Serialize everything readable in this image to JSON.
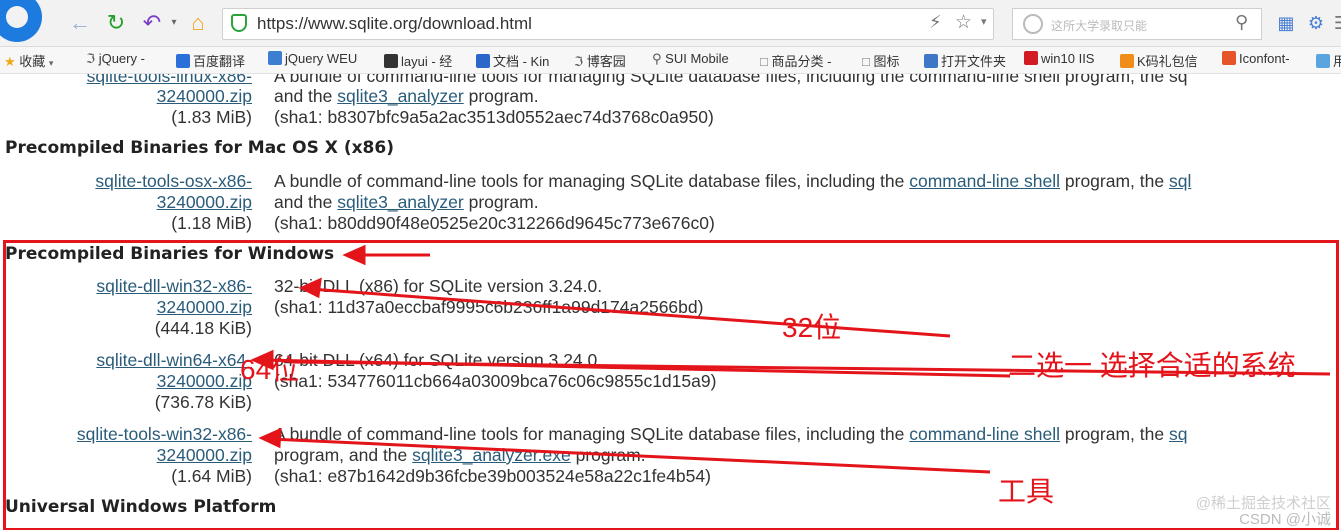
{
  "browser": {
    "url": "https://www.sqlite.org/download.html",
    "search_placeholder": "这所大学录取只能",
    "bookmarks": [
      "收藏",
      "jQuery -",
      "百度翻译",
      "jQuery WEU",
      "layui - 经",
      "文档 - Kin",
      "博客园",
      "SUI Mobile",
      "商品分类 -",
      "图标",
      "打开文件夹",
      "win10 IIS",
      "K码礼包信",
      "Iconfont-",
      "用"
    ]
  },
  "page": {
    "top_partial": {
      "file_top": "sqlite-tools-linux-x86-",
      "desc_top": "A bundle of command-line tools for managing SQLite database files, including the command-line shell program, the sq",
      "file_bottom": "3240000.zip",
      "size": "(1.83 MiB)",
      "desc_line2_prefix": "and the ",
      "desc_line2_link": "sqlite3_analyzer",
      "desc_line2_suffix": " program.",
      "sha1": "(sha1: b8307bfc9a5a2ac3513d0552aec74d3768c0a950)"
    },
    "mac_heading": "Precompiled Binaries for Mac OS X (x86)",
    "mac_entry": {
      "file_top": "sqlite-tools-osx-x86-",
      "file_bottom": "3240000.zip",
      "size": "(1.18 MiB)",
      "desc_prefix": "A bundle of command-line tools for managing SQLite database files, including the ",
      "desc_link": "command-line shell",
      "desc_suffix": " program, the ",
      "desc_tail_link": "sql",
      "desc_line2_prefix": "and the ",
      "desc_line2_link": "sqlite3_analyzer",
      "desc_line2_suffix": " program.",
      "sha1": "(sha1: b80dd90f48e0525e20c312266d9645c773e676c0)"
    },
    "win_heading": "Precompiled Binaries for Windows",
    "win_entries": [
      {
        "file_top": "sqlite-dll-win32-x86-",
        "file_bottom": "3240000.zip",
        "size": "(444.18 KiB)",
        "desc": "32-bit DLL (x86) for SQLite version 3.24.0.",
        "sha1": "(sha1: 11d37a0eccbaf9995c6b236ff1a99d174a2566bd)"
      },
      {
        "file_top": "sqlite-dll-win64-x64-",
        "file_bottom": "3240000.zip",
        "size": "(736.78 KiB)",
        "desc": "64-bit DLL (x64) for SQLite version 3.24.0.",
        "sha1": "(sha1: 534776011cb664a03009bca76c06c9855c1d15a9)"
      },
      {
        "file_top": "sqlite-tools-win32-x86-",
        "file_bottom": "3240000.zip",
        "size": "(1.64 MiB)",
        "desc_prefix": "A bundle of command-line tools for managing SQLite database files, including the ",
        "desc_link": "command-line shell",
        "desc_suffix": " program, the ",
        "desc_tail_link": "sq",
        "desc_line2_prefix": "program, and the ",
        "desc_line2_link": "sqlite3_analyzer.exe",
        "desc_line2_suffix": " program.",
        "sha1": "(sha1: e87b1642d9b36fcbe39b003524e58a22c1fe4b54)"
      }
    ],
    "uwp_heading": "Universal Windows Platform"
  },
  "annotations": {
    "label_32": "32位",
    "label_64": "64位",
    "label_choose": "二选一   选择合适的系统",
    "label_tools": "工具",
    "color": "#e4141b"
  },
  "watermark": "@稀土掘金技术社区",
  "watermark2": "CSDN @小诚"
}
